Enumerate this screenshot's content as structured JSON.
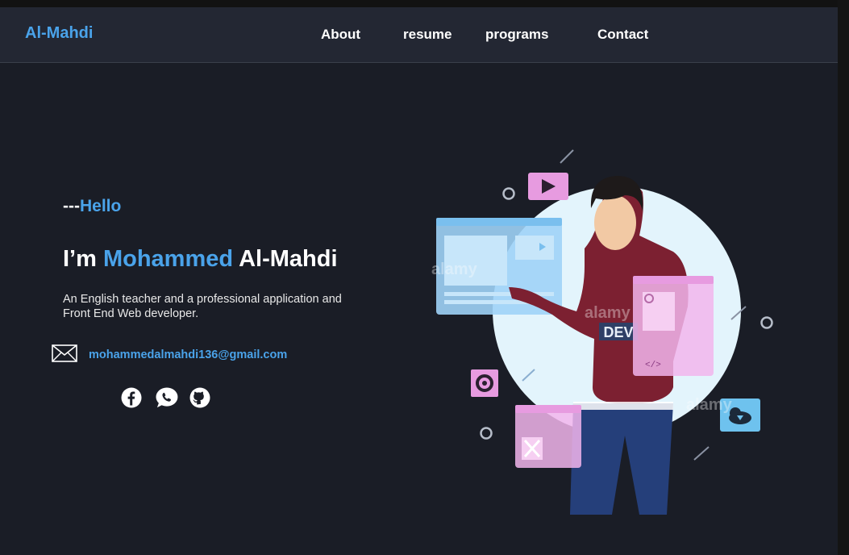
{
  "nav": {
    "brand": "Al-Mahdi",
    "links": [
      "About",
      "resume",
      "programs",
      "Contact"
    ]
  },
  "hero": {
    "greeting_prefix": "---",
    "greeting": "Hello",
    "intro": "I’m ",
    "first_name": "Mohammed",
    "last_name": " Al-Mahdi",
    "description": "An English teacher and a professional application and Front End Web developer.",
    "email": "mohammedalmahdi136@gmail.com",
    "social_icons": [
      "facebook-icon",
      "whatsapp-icon",
      "github-icon"
    ],
    "illustration_label": "DEV",
    "watermark": "alamy"
  },
  "colors": {
    "accent": "#4aa3ea",
    "background": "#1a1d26",
    "navbar": "#232733"
  }
}
